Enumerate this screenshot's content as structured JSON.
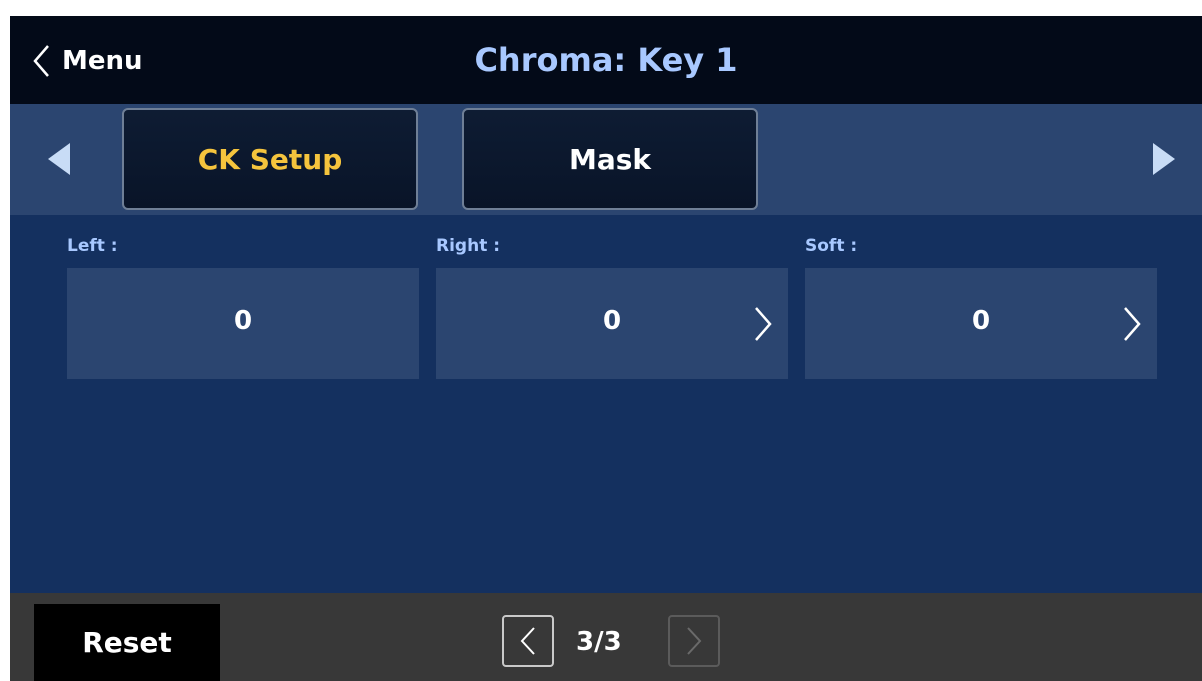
{
  "header": {
    "back_label": "Menu",
    "title": "Chroma: Key 1"
  },
  "tabs": [
    {
      "label": "CK Setup",
      "active": true
    },
    {
      "label": "Mask",
      "active": false
    }
  ],
  "fields": [
    {
      "label": "Left :",
      "value": "0",
      "has_chevron": false
    },
    {
      "label": "Right :",
      "value": "0",
      "has_chevron": true
    },
    {
      "label": "Soft :",
      "value": "0",
      "has_chevron": true
    }
  ],
  "footer": {
    "reset_label": "Reset",
    "page_indicator": "3/3"
  },
  "colors": {
    "accent_active_tab": "#f5c43d",
    "title": "#a8c8ff",
    "background": "#14305f"
  },
  "icons": {
    "back": "chevron-left-icon",
    "tab_prev": "triangle-left-icon",
    "tab_next": "triangle-right-icon",
    "field_next": "chevron-right-icon",
    "page_prev": "chevron-left-icon",
    "page_next": "chevron-right-icon"
  }
}
